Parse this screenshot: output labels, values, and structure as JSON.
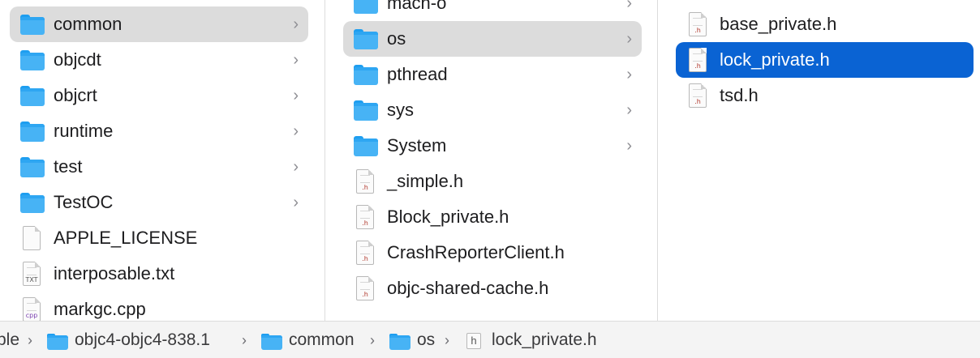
{
  "column1": {
    "items": [
      {
        "label": "common",
        "kind": "folder",
        "chevron": "›"
      },
      {
        "label": "objcdt",
        "kind": "folder",
        "chevron": "›"
      },
      {
        "label": "objcrt",
        "kind": "folder",
        "chevron": "›"
      },
      {
        "label": "runtime",
        "kind": "folder",
        "chevron": "›"
      },
      {
        "label": "test",
        "kind": "folder",
        "chevron": "›"
      },
      {
        "label": "TestOC",
        "kind": "folder",
        "chevron": "›"
      },
      {
        "label": "APPLE_LICENSE",
        "kind": "blank-file"
      },
      {
        "label": "interposable.txt",
        "kind": "file",
        "ext": "TXT"
      },
      {
        "label": "markgc.cpp",
        "kind": "file",
        "ext": "cpp"
      }
    ]
  },
  "column2": {
    "items": [
      {
        "label": "mach-o",
        "kind": "folder",
        "chevron": "›"
      },
      {
        "label": "os",
        "kind": "folder",
        "chevron": "›"
      },
      {
        "label": "pthread",
        "kind": "folder",
        "chevron": "›"
      },
      {
        "label": "sys",
        "kind": "folder",
        "chevron": "›"
      },
      {
        "label": "System",
        "kind": "folder",
        "chevron": "›"
      },
      {
        "label": "_simple.h",
        "kind": "file",
        "ext": ".h"
      },
      {
        "label": "Block_private.h",
        "kind": "file",
        "ext": ".h"
      },
      {
        "label": "CrashReporterClient.h",
        "kind": "file",
        "ext": ".h"
      },
      {
        "label": "objc-shared-cache.h",
        "kind": "file",
        "ext": ".h"
      }
    ]
  },
  "column3": {
    "items": [
      {
        "label": "base_private.h",
        "kind": "file",
        "ext": ".h"
      },
      {
        "label": "lock_private.h",
        "kind": "file",
        "ext": ".h"
      },
      {
        "label": "tsd.h",
        "kind": "file",
        "ext": ".h"
      }
    ]
  },
  "pathbar": {
    "first": "ple",
    "separator": "›",
    "crumbs": [
      "objc4-objc4-838.1",
      "common",
      "os",
      "lock_private.h"
    ],
    "file_icon_glyph": "h"
  },
  "colors": {
    "selection_active": "#0a63d3",
    "selection_inactive": "#dcdcdc",
    "folder": "#47b3f5"
  }
}
